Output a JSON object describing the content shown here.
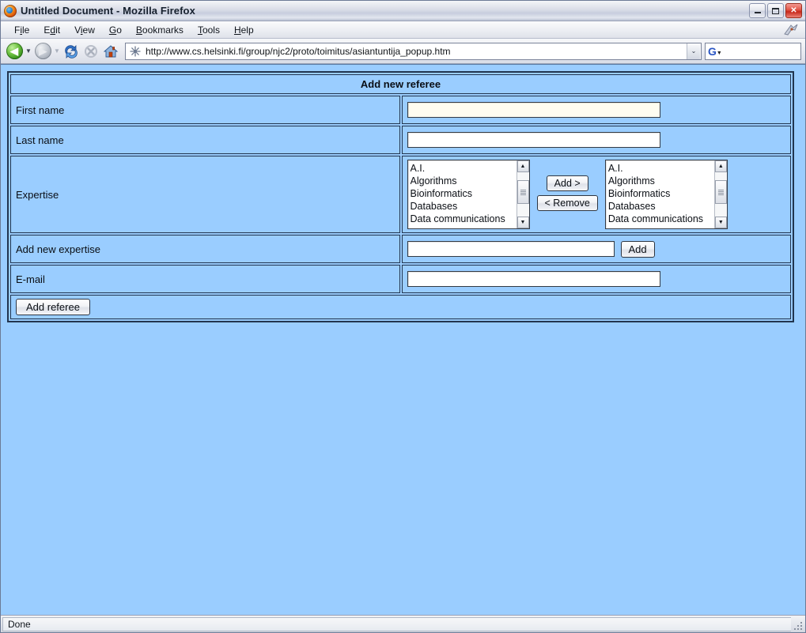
{
  "window": {
    "title": "Untitled Document - Mozilla Firefox",
    "app_icon": "firefox-icon",
    "minimize_label": "",
    "maximize_label": "",
    "close_label": "✕"
  },
  "menubar": {
    "items": [
      {
        "name": "file",
        "pre": "F",
        "key": "i",
        "post": "le"
      },
      {
        "name": "edit",
        "pre": "E",
        "key": "d",
        "post": "it"
      },
      {
        "name": "view",
        "pre": "V",
        "key": "i",
        "post": "ew"
      },
      {
        "name": "go",
        "pre": "",
        "key": "G",
        "post": "o"
      },
      {
        "name": "bookmarks",
        "pre": "",
        "key": "B",
        "post": "ookmarks"
      },
      {
        "name": "tools",
        "pre": "",
        "key": "T",
        "post": "ools"
      },
      {
        "name": "help",
        "pre": "",
        "key": "H",
        "post": "elp"
      }
    ],
    "throbber_icon": "firefox-throbber-icon"
  },
  "navbar": {
    "back_icon": "back-arrow-icon",
    "back_glyph": "◀",
    "forward_icon": "forward-arrow-icon",
    "forward_glyph": "▶",
    "caret_glyph": "▼",
    "reload_icon": "reload-icon",
    "stop_icon": "stop-icon",
    "home_icon": "home-icon",
    "url": "http://www.cs.helsinki.fi/group/njc2/proto/toimitus/asiantuntija_popup.htm",
    "url_placeholder": "",
    "favicon": "page-favicon",
    "url_dropdown_glyph": "⌄",
    "search_engine_icon": "google-icon",
    "search_value": "",
    "search_placeholder": "",
    "search_caret_glyph": "▼"
  },
  "page": {
    "background_color": "#9acdff",
    "header_background_color": "#cccccc",
    "border_color": "#22354f",
    "title": "Add new referee",
    "rows": [
      {
        "name": "first-name",
        "label": "First name",
        "value": "",
        "placeholder": ""
      },
      {
        "name": "last-name",
        "label": "Last name",
        "value": "",
        "placeholder": ""
      },
      {
        "name": "expertise",
        "label": "Expertise"
      },
      {
        "name": "add-new-expertise",
        "label": "Add new expertise",
        "value": "",
        "placeholder": ""
      },
      {
        "name": "email",
        "label": "E-mail",
        "value": "",
        "placeholder": ""
      }
    ],
    "expertise": {
      "available_options": [
        "A.I.",
        "Algorithms",
        "Bioinformatics",
        "Databases",
        "Data communications"
      ],
      "selected_options": [
        "A.I.",
        "Algorithms",
        "Bioinformatics",
        "Databases",
        "Data communications"
      ],
      "add_button": "Add >",
      "remove_button": "< Remove",
      "scroll_up_glyph": "▲",
      "scroll_down_glyph": "▼"
    },
    "add_expertise_button": "Add",
    "submit_button": "Add referee"
  },
  "statusbar": {
    "text": "Done",
    "resize_grip_icon": "resize-grip-icon"
  }
}
